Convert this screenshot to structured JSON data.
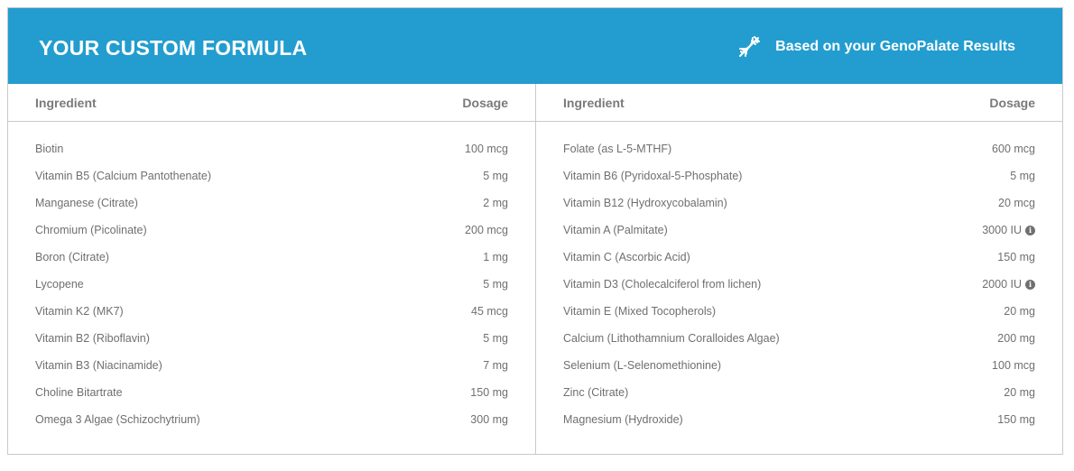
{
  "header": {
    "title": "YOUR CUSTOM FORMULA",
    "subtitle": "Based on your GenoPalate Results",
    "icon": "dna-icon",
    "background_color": "#239dcf"
  },
  "left_table": {
    "col_ingredient": "Ingredient",
    "col_dosage": "Dosage",
    "rows": [
      {
        "name": "Biotin",
        "dose": "100 mcg"
      },
      {
        "name": "Vitamin B5 (Calcium Pantothenate)",
        "dose": "5 mg"
      },
      {
        "name": "Manganese (Citrate)",
        "dose": "2 mg"
      },
      {
        "name": "Chromium (Picolinate)",
        "dose": "200 mcg"
      },
      {
        "name": "Boron (Citrate)",
        "dose": "1 mg"
      },
      {
        "name": "Lycopene",
        "dose": "5 mg"
      },
      {
        "name": "Vitamin K2 (MK7)",
        "dose": "45 mcg"
      },
      {
        "name": "Vitamin B2 (Riboflavin)",
        "dose": "5 mg"
      },
      {
        "name": "Vitamin B3 (Niacinamide)",
        "dose": "7 mg"
      },
      {
        "name": "Choline Bitartrate",
        "dose": "150 mg"
      },
      {
        "name": "Omega 3 Algae (Schizochytrium)",
        "dose": "300 mg"
      }
    ]
  },
  "right_table": {
    "col_ingredient": "Ingredient",
    "col_dosage": "Dosage",
    "rows": [
      {
        "name": "Folate (as L-5-MTHF)",
        "dose": "600 mcg",
        "info": false
      },
      {
        "name": "Vitamin B6 (Pyridoxal-5-Phosphate)",
        "dose": "5 mg",
        "info": false
      },
      {
        "name": "Vitamin B12 (Hydroxycobalamin)",
        "dose": "20 mcg",
        "info": false
      },
      {
        "name": "Vitamin A (Palmitate)",
        "dose": "3000 IU",
        "info": true
      },
      {
        "name": "Vitamin C (Ascorbic Acid)",
        "dose": "150 mg",
        "info": false
      },
      {
        "name": "Vitamin D3 (Cholecalciferol from lichen)",
        "dose": "2000 IU",
        "info": true
      },
      {
        "name": "Vitamin E (Mixed Tocopherols)",
        "dose": "20 mg",
        "info": false
      },
      {
        "name": "Calcium (Lithothamnium Coralloides Algae)",
        "dose": "200 mg",
        "info": false
      },
      {
        "name": "Selenium (L-Selenomethionine)",
        "dose": "100 mcg",
        "info": false
      },
      {
        "name": "Zinc (Citrate)",
        "dose": "20 mg",
        "info": false
      },
      {
        "name": "Magnesium (Hydroxide)",
        "dose": "150 mg",
        "info": false
      }
    ]
  },
  "info_icon": {
    "glyph": "i",
    "icon": "info-icon"
  }
}
